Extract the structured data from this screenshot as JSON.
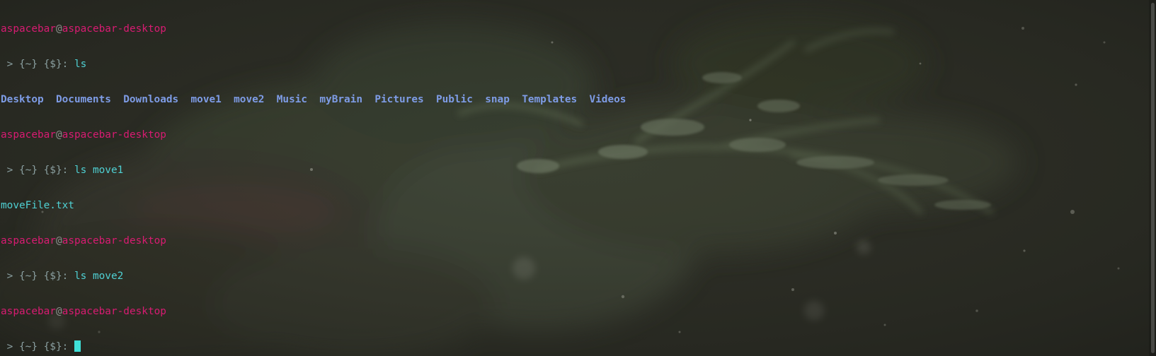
{
  "terminal": {
    "user": "aspacebar",
    "at": "@",
    "host": "aspacebar-desktop",
    "prompt_prefix": " > {~} {$}: ",
    "commands": {
      "ls": "ls",
      "ls_move1": "ls move1",
      "ls_move2": "ls move2"
    },
    "ls_output": [
      "Desktop",
      "Documents",
      "Downloads",
      "move1",
      "move2",
      "Music",
      "myBrain",
      "Pictures",
      "Public",
      "snap",
      "Templates",
      "Videos"
    ],
    "move1_output": "moveFile.txt"
  },
  "colors": {
    "user_host": "#d81b72",
    "command": "#4fd0d3",
    "directory": "#7e9ce6",
    "cursor": "#3fe0d8"
  }
}
